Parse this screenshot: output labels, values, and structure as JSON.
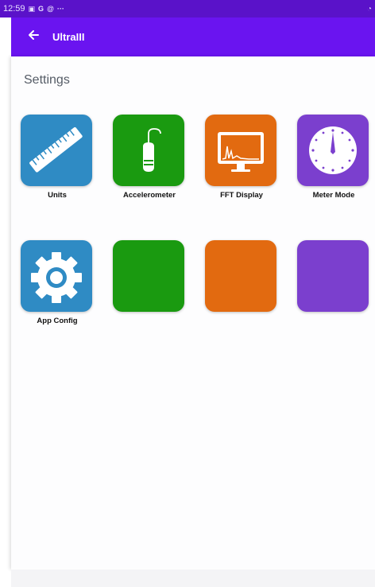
{
  "status": {
    "time": "12:59",
    "indicators": "G",
    "extra": "···"
  },
  "app": {
    "title": "UltraIII"
  },
  "section": {
    "title": "Settings"
  },
  "tiles": [
    {
      "label": "Units",
      "color": "#2f8bc4",
      "icon": "ruler-icon"
    },
    {
      "label": "Accelerometer",
      "color": "#1a9a10",
      "icon": "sensor-probe-icon"
    },
    {
      "label": "FFT Display",
      "color": "#e26a10",
      "icon": "monitor-spectrum-icon"
    },
    {
      "label": "Meter Mode",
      "color": "#7b3fce",
      "icon": "gauge-dial-icon"
    },
    {
      "label": "App Config",
      "color": "#2f8bc4",
      "icon": "gear-icon"
    },
    {
      "label": "",
      "color": "#1a9a10",
      "icon": ""
    },
    {
      "label": "",
      "color": "#e26a10",
      "icon": ""
    },
    {
      "label": "",
      "color": "#7b3fce",
      "icon": ""
    }
  ]
}
